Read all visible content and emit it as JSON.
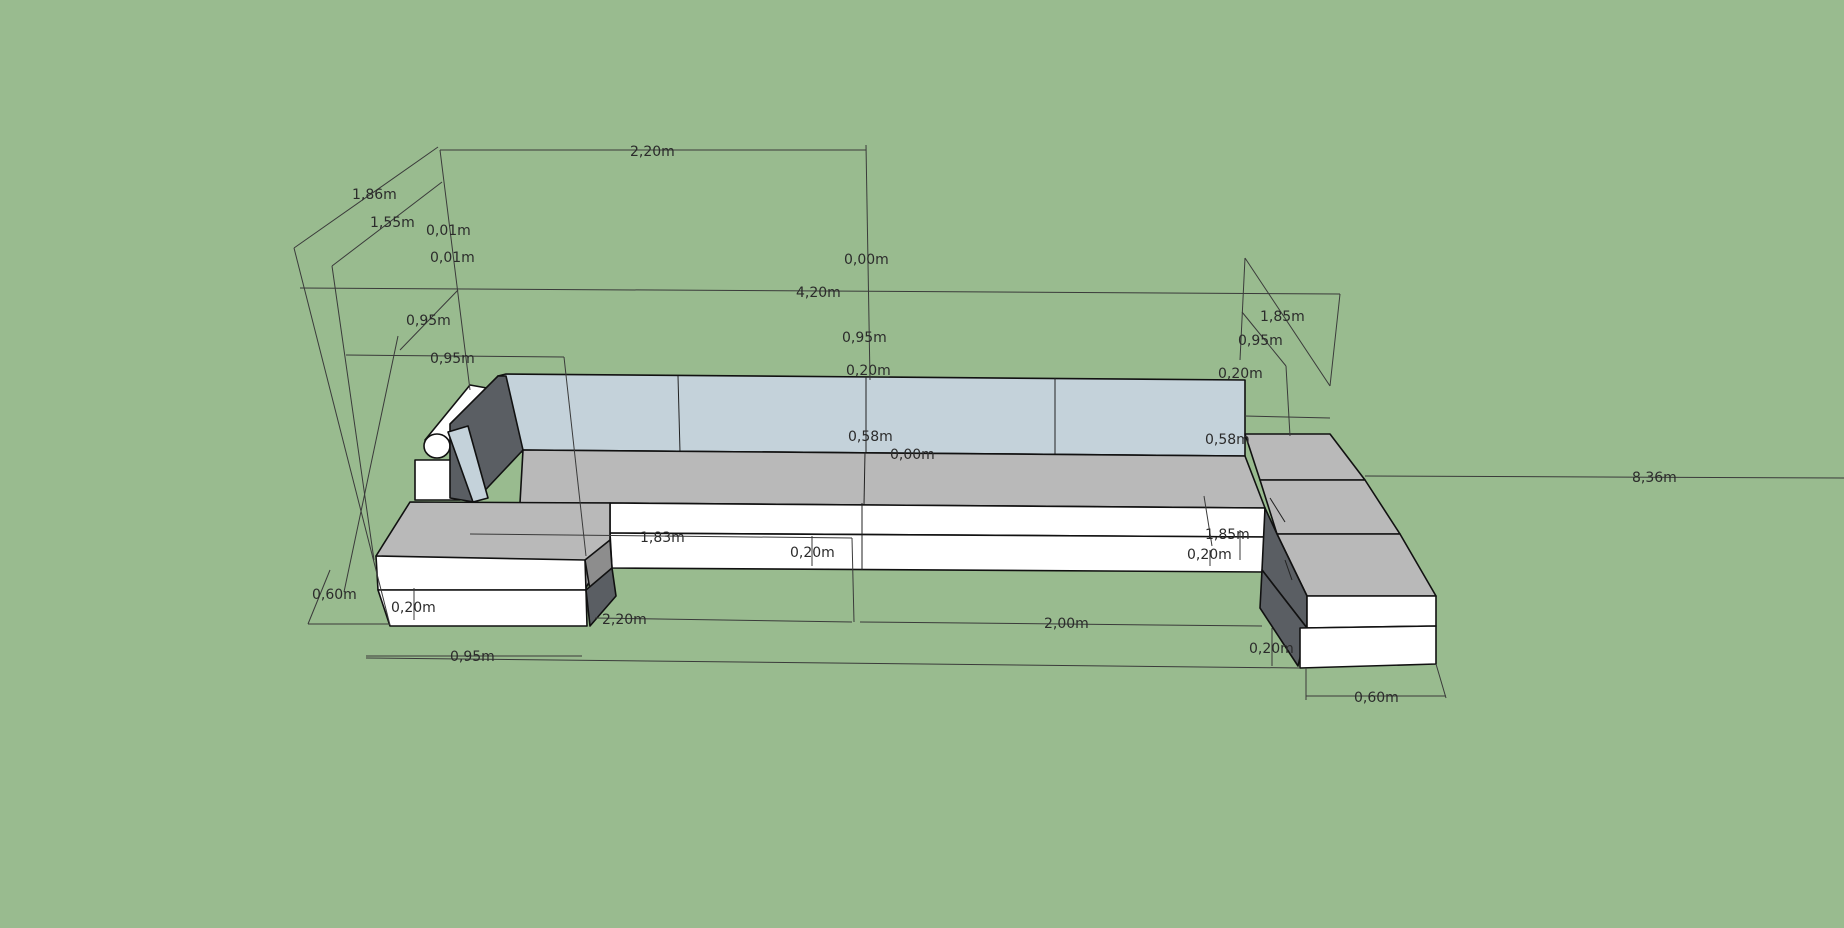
{
  "colors": {
    "background": "#99bb8f",
    "backrest_front": "#c4d2da",
    "seat_top": "#b9b9b9",
    "cushion_side": "#ffffff",
    "dark_side": "#5a5e63",
    "mid_side": "#8d8d8d",
    "dimension_line": "#3a3a3a",
    "dimension_text": "#2b2b2b"
  },
  "dimensions": [
    "2,20m",
    "1,86m",
    "1,55m",
    "0,01m",
    "0,01m",
    "0,00m",
    "4,20m",
    "1,85m",
    "0,95m",
    "0,95m",
    "0,95m",
    "0,95m",
    "0,20m",
    "0,20m",
    "0,58m",
    "0,00m",
    "0,58m",
    "8,36m",
    "1,83m",
    "0,20m",
    "1,85m",
    "0,20m",
    "0,60m",
    "0,20m",
    "2,20m",
    "2,00m",
    "0,20m",
    "0,95m",
    "0,60m"
  ]
}
